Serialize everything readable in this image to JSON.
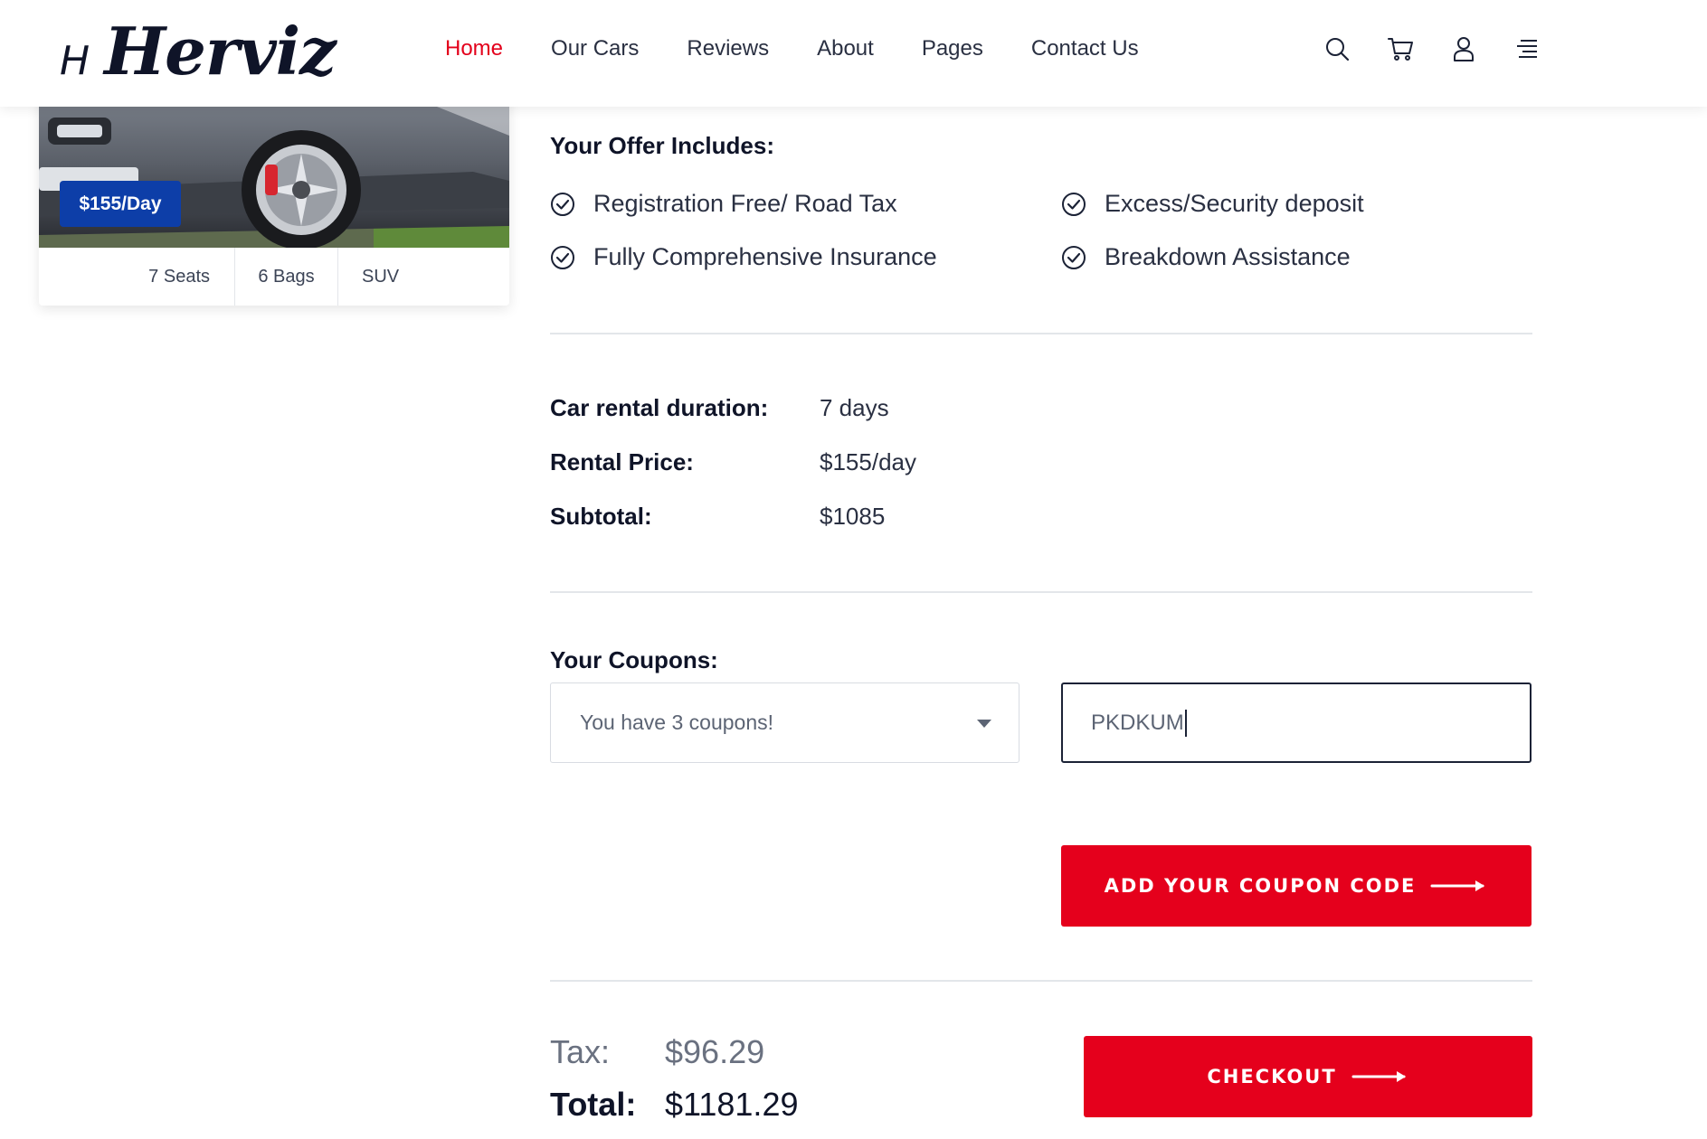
{
  "brand": {
    "mark": "H",
    "name": "Herviz"
  },
  "nav": {
    "items": [
      "Home",
      "Our Cars",
      "Reviews",
      "About",
      "Pages",
      "Contact Us"
    ],
    "active": "Home"
  },
  "header_icons": [
    "search-icon",
    "cart-icon",
    "user-icon",
    "menu-icon"
  ],
  "car": {
    "price_badge": "$155/Day",
    "specs": {
      "seats": "7 Seats",
      "bags": "6 Bags",
      "type": "SUV"
    }
  },
  "offer": {
    "title": "Your Offer Includes:",
    "items": [
      "Registration Free/ Road Tax",
      "Excess/Security deposit",
      "Fully Comprehensive Insurance",
      "Breakdown Assistance"
    ]
  },
  "summary": {
    "duration_label": "Car rental duration:",
    "duration_value": "7 days",
    "price_label": "Rental Price:",
    "price_value": "$155/day",
    "subtotal_label": "Subtotal:",
    "subtotal_value": "$1085"
  },
  "coupons": {
    "title": "Your Coupons:",
    "select_value": "You have 3 coupons!",
    "input_value": "PKDKUM",
    "add_button": "ADD YOUR COUPON CODE"
  },
  "totals": {
    "tax_label": "Tax:",
    "tax_value": "$96.29",
    "total_label": "Total:",
    "total_value": "$1181.29",
    "checkout_button": "CHECKOUT"
  },
  "colors": {
    "accent_red": "#e5001c",
    "nav_active": "#e3001b",
    "badge_blue": "#0d3ea8",
    "text_dark": "#0f1428"
  }
}
